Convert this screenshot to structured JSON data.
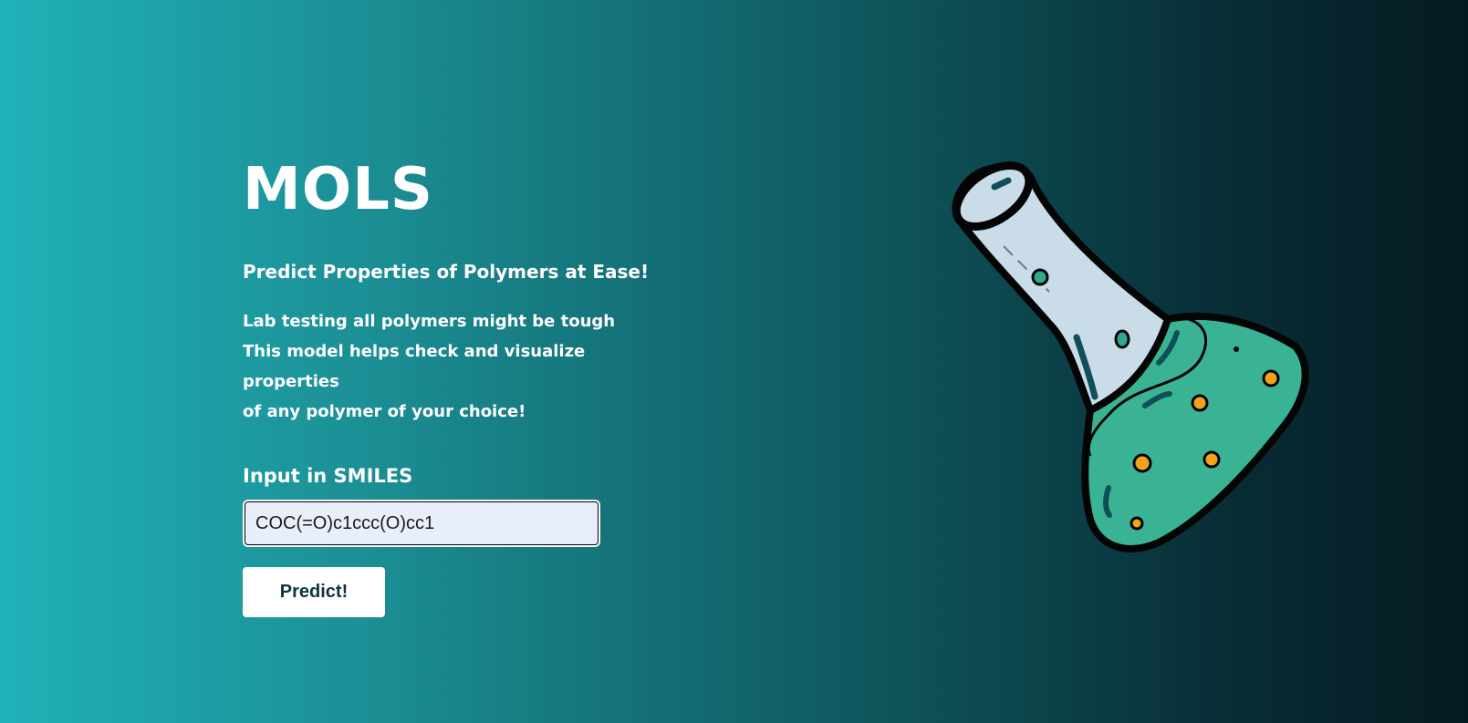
{
  "brand": {
    "title": "MOLS"
  },
  "hero": {
    "tagline": "Predict Properties of Polymers at Ease!",
    "description_lines": [
      "Lab testing all polymers might be tough",
      "This model helps check and visualize properties",
      "of any polymer of your choice!"
    ]
  },
  "form": {
    "input_label": "Input in SMILES",
    "input_value": "COC(=O)c1ccc(O)cc1",
    "submit_label": "Predict!"
  },
  "illustration": {
    "icon": "flask-icon",
    "glass_color": "#c9dce8",
    "liquid_color": "#3ab394",
    "outline_color": "#050505",
    "bubble_color": "#f4a21b"
  }
}
